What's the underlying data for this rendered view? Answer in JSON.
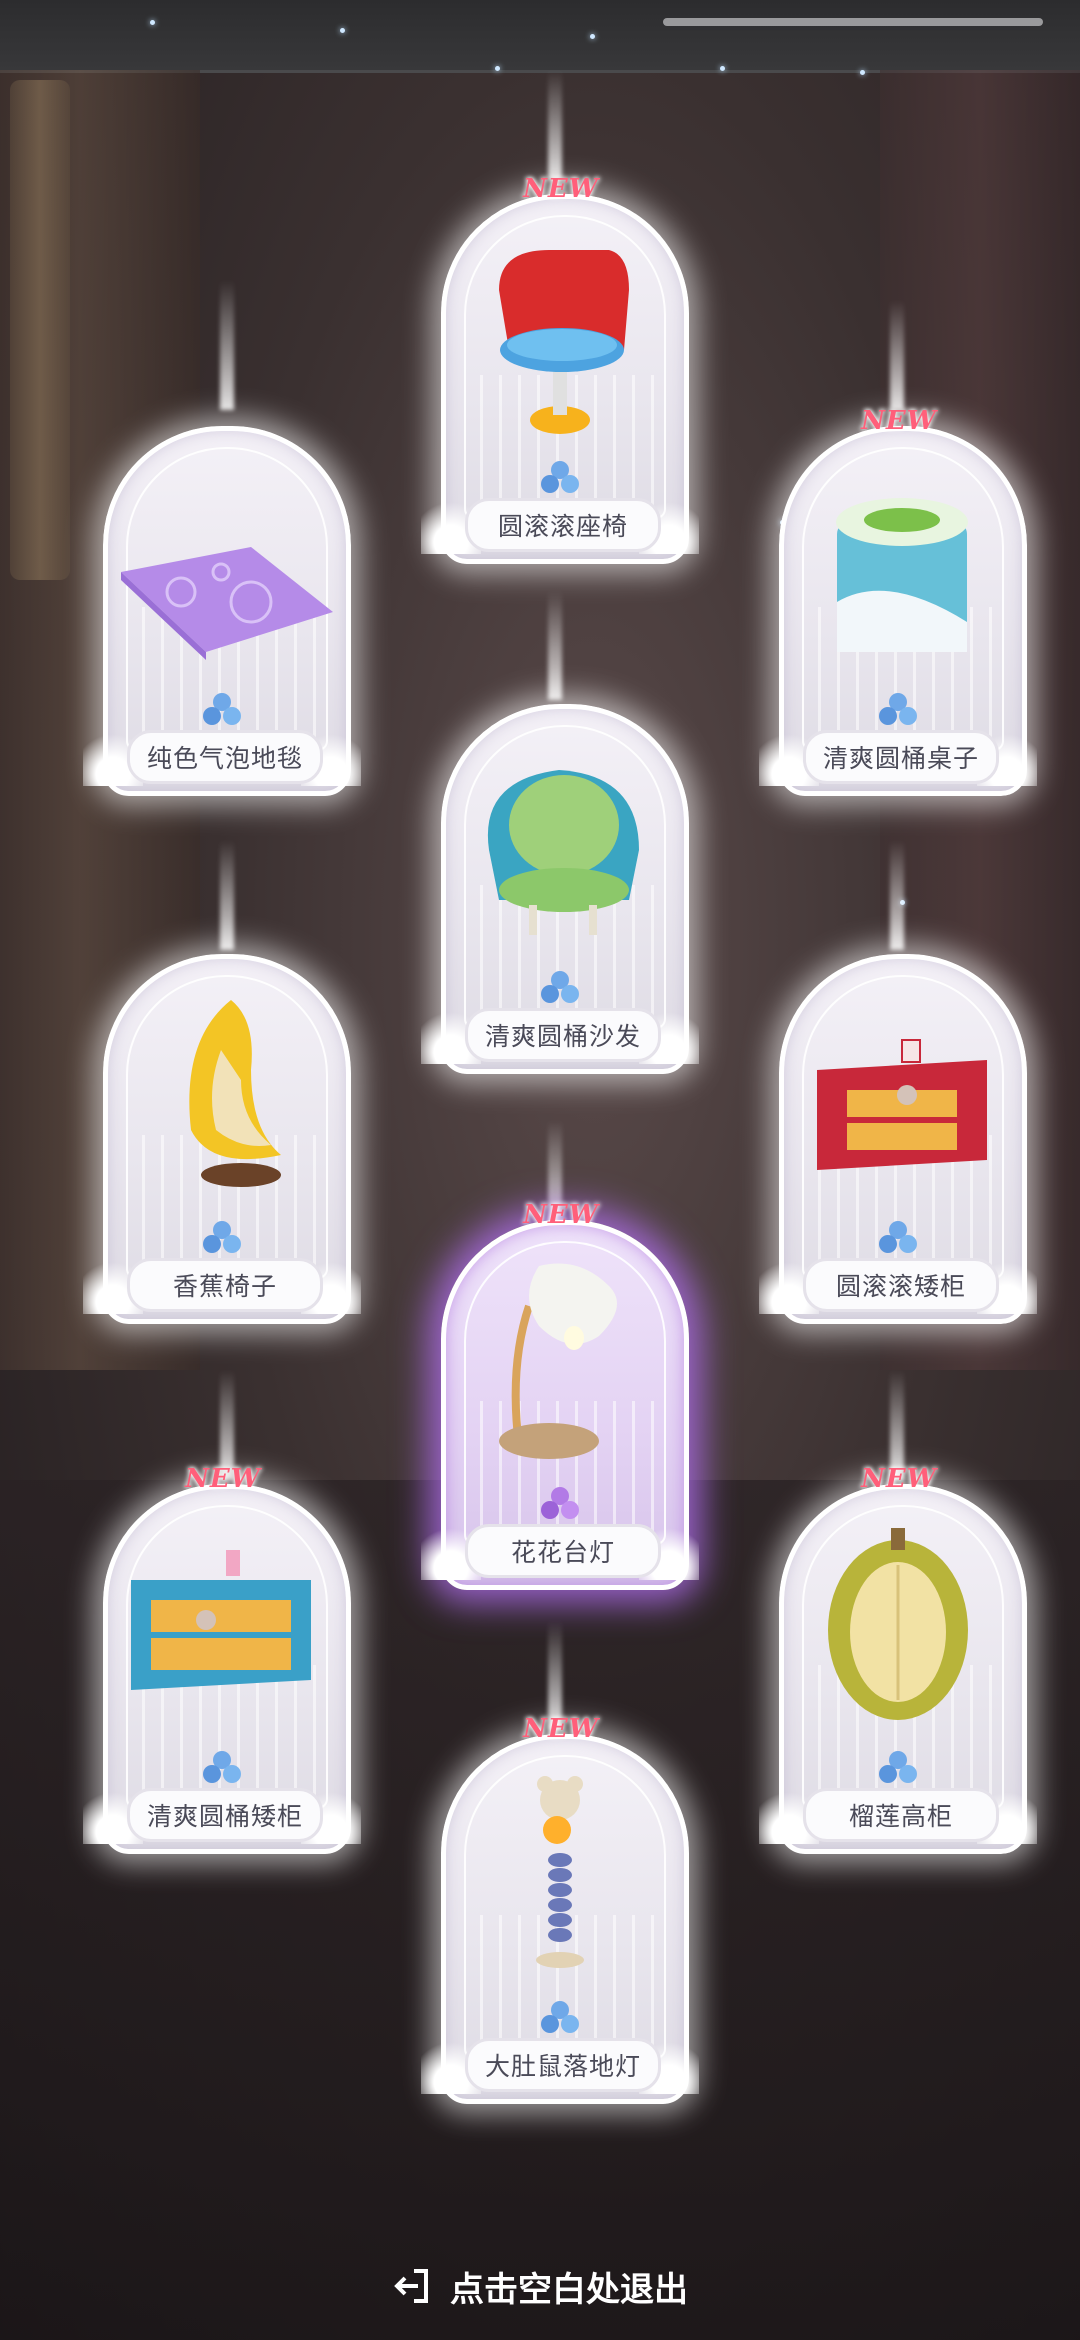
{
  "badge_text": "NEW",
  "exit_hint": "点击空白处退出",
  "colors": {
    "badge": "#ff5f7a",
    "gem_blue": "#6fa8e8",
    "gem_purple": "#b27ae6",
    "highlight_purple": "#af6eeb"
  },
  "cards": [
    {
      "name": "圆滚滚座椅",
      "is_new": true,
      "rarity": "blue",
      "icon": "red-swivel-chair"
    },
    {
      "name": "纯色气泡地毯",
      "is_new": false,
      "rarity": "blue",
      "icon": "purple-bubble-rug"
    },
    {
      "name": "清爽圆桶桌子",
      "is_new": true,
      "rarity": "blue",
      "icon": "drink-can-table"
    },
    {
      "name": "清爽圆桶沙发",
      "is_new": false,
      "rarity": "blue",
      "icon": "drink-can-sofa"
    },
    {
      "name": "香蕉椅子",
      "is_new": false,
      "rarity": "blue",
      "icon": "banana-chair"
    },
    {
      "name": "圆滚滚矮柜",
      "is_new": false,
      "rarity": "blue",
      "icon": "red-low-cabinet"
    },
    {
      "name": "花花台灯",
      "is_new": true,
      "rarity": "purple",
      "icon": "flower-table-lamp"
    },
    {
      "name": "清爽圆桶矮柜",
      "is_new": true,
      "rarity": "blue",
      "icon": "blue-low-cabinet"
    },
    {
      "name": "榴莲高柜",
      "is_new": true,
      "rarity": "blue",
      "icon": "durian-tall-cabinet"
    },
    {
      "name": "大肚鼠落地灯",
      "is_new": true,
      "rarity": "blue",
      "icon": "mouse-floor-lamp"
    }
  ]
}
